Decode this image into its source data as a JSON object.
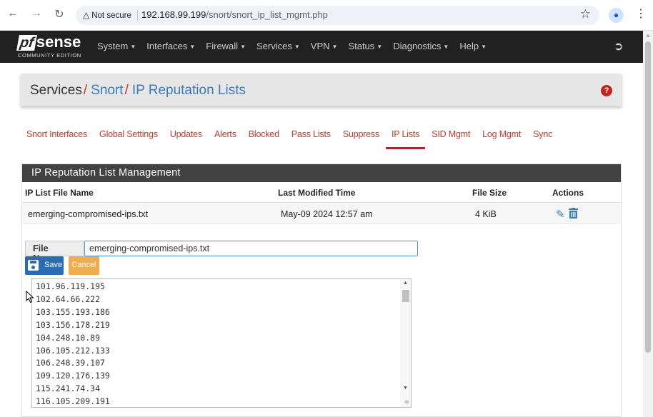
{
  "browser": {
    "security_label": "Not secure",
    "url_host": "192.168.99.199",
    "url_path": "/snort/snort_ip_list_mgmt.php"
  },
  "navbar": {
    "logo_main": "sense",
    "logo_prefix": "pf",
    "logo_edition": "COMMUNITY EDITION",
    "menu": [
      "System",
      "Interfaces",
      "Firewall",
      "Services",
      "VPN",
      "Status",
      "Diagnostics",
      "Help"
    ]
  },
  "breadcrumb": {
    "root": "Services",
    "level2": "Snort",
    "level3": "IP Reputation Lists"
  },
  "tabs": [
    "Snort Interfaces",
    "Global Settings",
    "Updates",
    "Alerts",
    "Blocked",
    "Pass Lists",
    "Suppress",
    "IP Lists",
    "SID Mgmt",
    "Log Mgmt",
    "Sync"
  ],
  "active_tab": "IP Lists",
  "panel": {
    "title": "IP Reputation List Management",
    "columns": [
      "IP List File Name",
      "Last Modified Time",
      "File Size",
      "Actions"
    ],
    "rows": [
      {
        "file": "emerging-compromised-ips.txt",
        "modified": "May-09 2024 12:57 am",
        "size": "4 KiB"
      }
    ]
  },
  "editor": {
    "file_name_label": "File Name:",
    "file_name_value": "emerging-compromised-ips.txt",
    "save_label": "Save",
    "cancel_label": "Cancel",
    "lines": [
      "101.96.119.195",
      "102.64.66.222",
      "103.155.193.186",
      "103.156.178.219",
      "104.248.10.89",
      "106.105.212.133",
      "106.248.39.107",
      "109.120.176.139",
      "115.241.74.34",
      "116.105.209.191"
    ]
  },
  "colors": {
    "accent_red": "#c0392b",
    "link_blue": "#3c7ab8",
    "save_blue": "#2a6db5",
    "cancel_orange": "#f0ad4e",
    "navbar_bg": "#212121"
  }
}
